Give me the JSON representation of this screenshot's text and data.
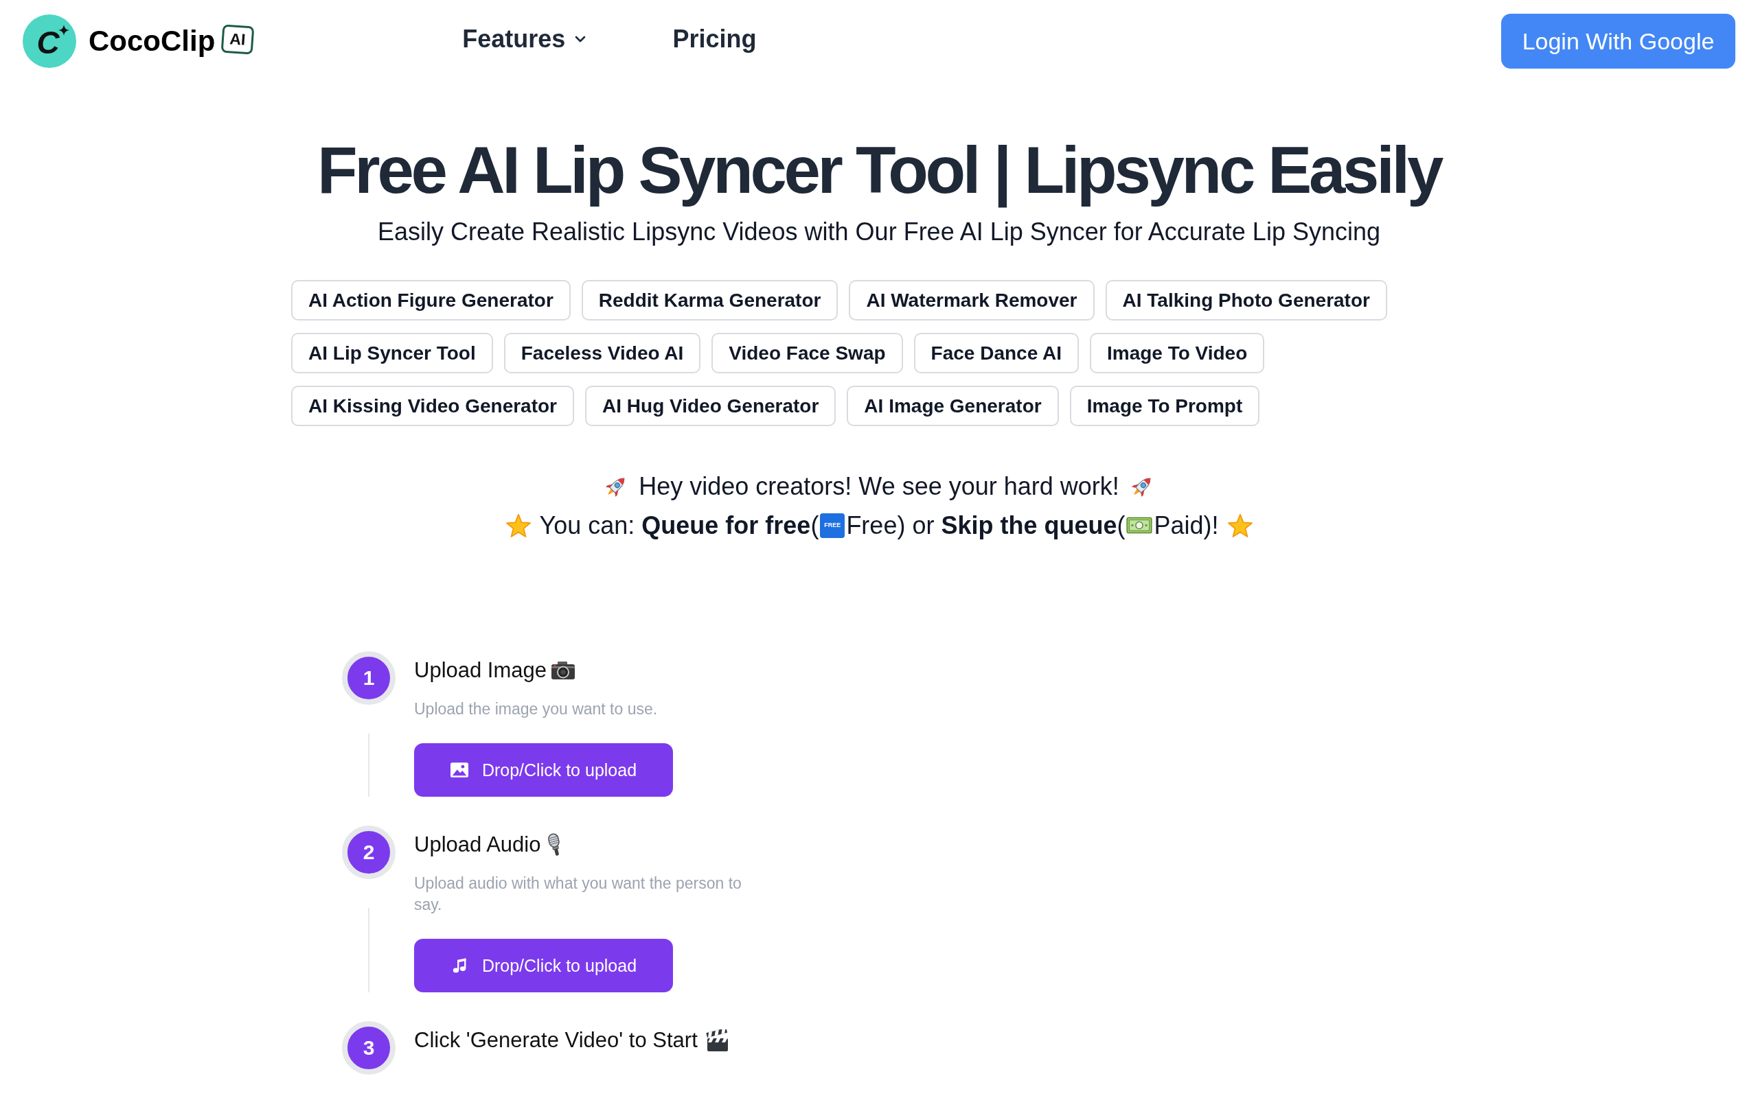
{
  "header": {
    "logo": {
      "mark": "C",
      "name": "CocoClip",
      "badge": "AI"
    },
    "nav": [
      {
        "label": "Features",
        "kind": "dropdown"
      },
      {
        "label": "Pricing",
        "kind": "link"
      }
    ],
    "login_button": "Login With Google"
  },
  "hero": {
    "title": "Free AI Lip Syncer Tool | Lipsync Easily",
    "subtitle": "Easily Create Realistic Lipsync Videos with Our Free AI Lip Syncer for Accurate Lip Syncing"
  },
  "tool_links": [
    "AI Action Figure Generator",
    "Reddit Karma Generator",
    "AI Watermark Remover",
    "AI Talking Photo Generator",
    "AI Lip Syncer Tool",
    "Faceless Video AI",
    "Video Face Swap",
    "Face Dance AI",
    "Image To Video",
    "AI Kissing Video Generator",
    "AI Hug Video Generator",
    "AI Image Generator",
    "Image To Prompt"
  ],
  "announcement": {
    "line_1": "Hey video creators! We see your hard work!",
    "line_2": [
      "You can: **Queue for free**(",
      "Free) or **Skip the queue**(",
      "Paid)!"
    ],
    "free_badge": "FREE"
  },
  "steps": [
    {
      "number": "1",
      "title": "Upload Image",
      "kind": "image",
      "description": "Upload the image you want to use.",
      "button": "Drop/Click to upload"
    },
    {
      "number": "2",
      "title": "Upload Audio",
      "kind": "audio",
      "description": "Upload audio with what you want the person to say.",
      "button": "Drop/Click to upload"
    },
    {
      "number": "3",
      "title": "Click 'Generate Video' to Start",
      "kind": "generate"
    }
  ]
}
